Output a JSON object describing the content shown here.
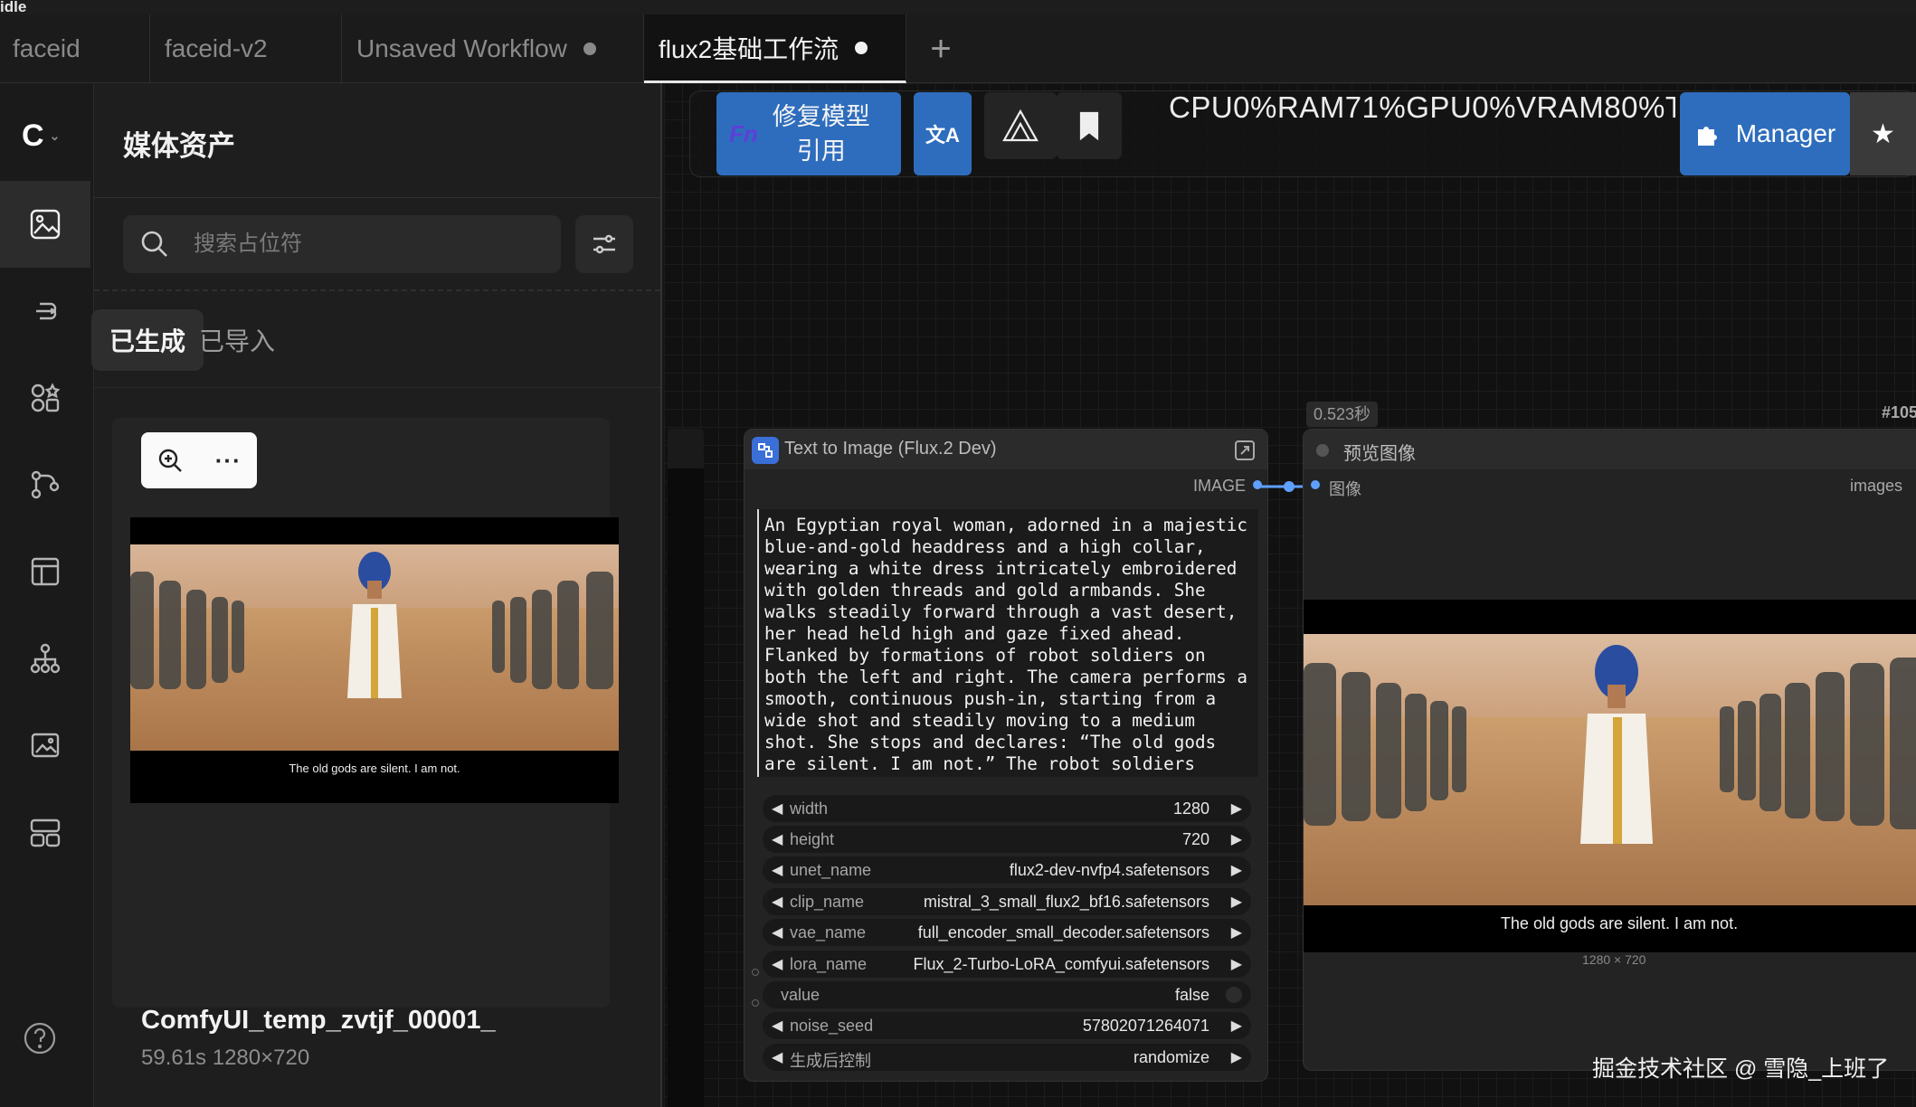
{
  "titlebar": {
    "text": "idle"
  },
  "tabs": [
    {
      "label": "faceid",
      "unsaved": false,
      "active": false
    },
    {
      "label": "faceid-v2",
      "unsaved": false,
      "active": false
    },
    {
      "label": "Unsaved Workflow",
      "unsaved": true,
      "active": false
    },
    {
      "label": "flux2基础工作流",
      "unsaved": true,
      "active": true
    }
  ],
  "tab_add_icon": "plus-icon",
  "rail": {
    "logo_icon": "comfy-logo-icon",
    "items": [
      {
        "icon": "media-assets-icon",
        "active": true
      },
      {
        "icon": "queue-icon",
        "active": false
      },
      {
        "icon": "node-library-icon",
        "active": false
      },
      {
        "icon": "model-library-icon",
        "active": false
      },
      {
        "icon": "workflows-icon",
        "active": false
      },
      {
        "icon": "templates-icon",
        "active": false
      },
      {
        "icon": "image-gallery-icon",
        "active": false
      },
      {
        "icon": "layout-icon",
        "active": false
      }
    ],
    "help_icon": "help-icon"
  },
  "panel": {
    "title": "媒体资产",
    "search_placeholder": "搜索占位符",
    "tabs": {
      "generated": "已生成",
      "imported": "已导入"
    },
    "card": {
      "caption": "The old gods are silent. I am not.",
      "name": "ComfyUI_temp_zvtjf_00001_",
      "meta": "59.61s  1280×720",
      "more": "···"
    }
  },
  "toolbar": {
    "repair_prefix": "Fn",
    "repair_line1": "修复模型",
    "repair_line2": "引用",
    "translate_glyph": "文A",
    "stats": "CPU0%RAM71%GPU0%VRAM80%T",
    "manager_label": "Manager",
    "star": "★"
  },
  "canvas": {
    "time_badge": "0.523秒",
    "node_id": "#105"
  },
  "node": {
    "title": "Text to Image (Flux.2 Dev)",
    "output_label": "IMAGE",
    "prompt": "An Egyptian royal woman, adorned in a majestic\nblue-and-gold headdress and a high collar,\nwearing a white dress intricately embroidered\nwith golden threads and gold armbands. She\nwalks steadily forward through a vast desert,\nher head held high and gaze fixed ahead.\nFlanked by formations of robot soldiers on\nboth the left and right. The camera performs a\nsmooth, continuous push-in, starting from a\nwide shot and steadily moving to a medium\nshot. She stops and declares: “The old gods\nare silent. I am not.” The robot soldiers",
    "widgets": [
      {
        "name": "width",
        "value": "1280"
      },
      {
        "name": "height",
        "value": "720"
      },
      {
        "name": "unet_name",
        "value": "flux2-dev-nvfp4.safetensors"
      },
      {
        "name": "clip_name",
        "value": "mistral_3_small_flux2_bf16.safetensors"
      },
      {
        "name": "vae_name",
        "value": "full_encoder_small_decoder.safetensors"
      },
      {
        "name": "lora_name",
        "value": "Flux_2-Turbo-LoRA_comfyui.safetensors"
      },
      {
        "name": "value",
        "value": "false"
      },
      {
        "name": "noise_seed",
        "value": "57802071264071"
      },
      {
        "name": "生成后控制",
        "value": "randomize"
      }
    ]
  },
  "preview_node": {
    "title": "预览图像",
    "input_label": "图像",
    "output_label": "images",
    "caption": "The old gods are silent. I am not.",
    "dims": "1280 × 720"
  },
  "watermark": "掘金技术社区 @ 雪隐_上班了",
  "colors": {
    "accent": "#2e6dbd",
    "link": "#5fa0ff",
    "bg": "#111111"
  }
}
